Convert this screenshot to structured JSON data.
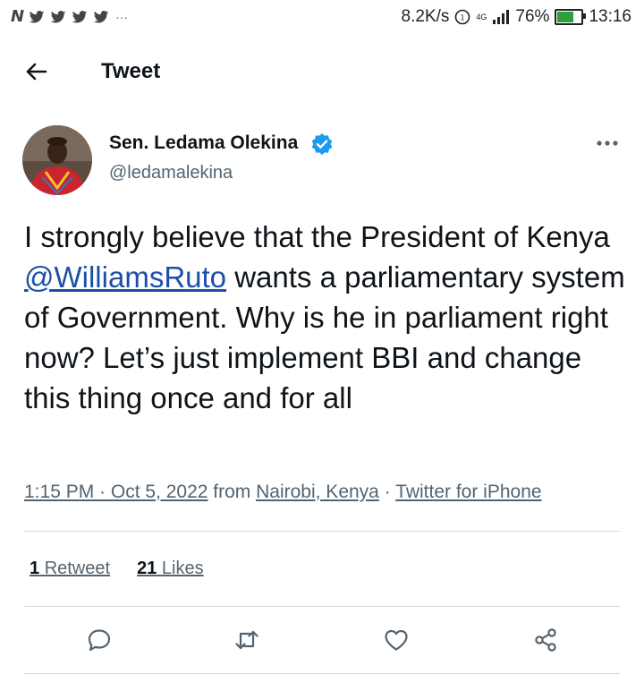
{
  "status_bar": {
    "left_icons": [
      "n-icon",
      "twitter-bird-icon",
      "twitter-bird-icon",
      "twitter-bird-icon",
      "twitter-bird-icon"
    ],
    "more": "···",
    "net_speed": "8.2K/s",
    "network": "4G",
    "battery": "76%",
    "battery_level": 0.76,
    "time": "13:16"
  },
  "header": {
    "title": "Tweet"
  },
  "tweet": {
    "author_name": "Sen. Ledama Olekina",
    "author_handle": "@ledamalekina",
    "text_part1": "I strongly believe that the President of Kenya ",
    "mention": "@WilliamsRuto",
    "text_part2": " wants a parliamentary system of Government. Why is he in parliament right now? Let’s just implement BBI and change this thing once and for all",
    "time_date": "1:15 PM · Oct 5, 2022",
    "from_label": " from ",
    "location": "Nairobi, Kenya",
    "sep": " · ",
    "client": "Twitter for iPhone"
  },
  "stats": {
    "retweet_count": "1",
    "retweet_label": "Retweet",
    "like_count": "21",
    "like_label": "Likes"
  },
  "colors": {
    "verified": "#1d9bf0",
    "link": "#1d4fa8",
    "secondary": "#536471",
    "divider": "#cfd9de",
    "battery": "#2e9e3e"
  }
}
